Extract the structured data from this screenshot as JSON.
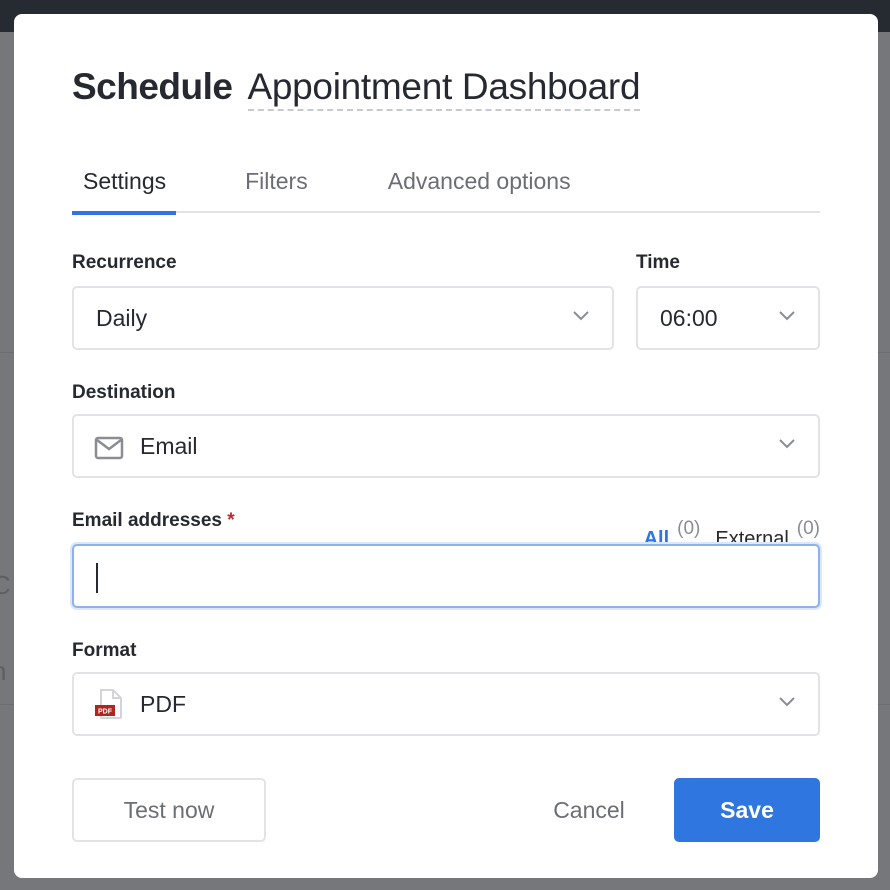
{
  "dialog": {
    "title_prefix": "Schedule",
    "title_name": "Appointment Dashboard"
  },
  "tabs": [
    {
      "label": "Settings",
      "active": true
    },
    {
      "label": "Filters",
      "active": false
    },
    {
      "label": "Advanced options",
      "active": false
    }
  ],
  "form": {
    "recurrence": {
      "label": "Recurrence",
      "value": "Daily",
      "icon": "chevron-down-icon"
    },
    "time": {
      "label": "Time",
      "value": "06:00",
      "icon": "chevron-down-icon"
    },
    "destination": {
      "label": "Destination",
      "value": "Email",
      "icon": "mail-icon"
    },
    "email_addresses": {
      "label": "Email addresses",
      "required_mark": "*",
      "value": "",
      "placeholder": "",
      "all_label": "All",
      "all_count": "(0)",
      "external_label": "External",
      "external_count": "(0)"
    },
    "format": {
      "label": "Format",
      "value": "PDF",
      "icon": "pdf-file-icon",
      "icon_badge": "PDF"
    }
  },
  "actions": {
    "test_now": "Test now",
    "cancel": "Cancel",
    "save": "Save"
  },
  "colors": {
    "accent": "#2f76e0",
    "required": "#c1272d",
    "pdf_badge": "#b0261f"
  },
  "background": {
    "partial_text_1": "C",
    "partial_text_2": "n"
  }
}
